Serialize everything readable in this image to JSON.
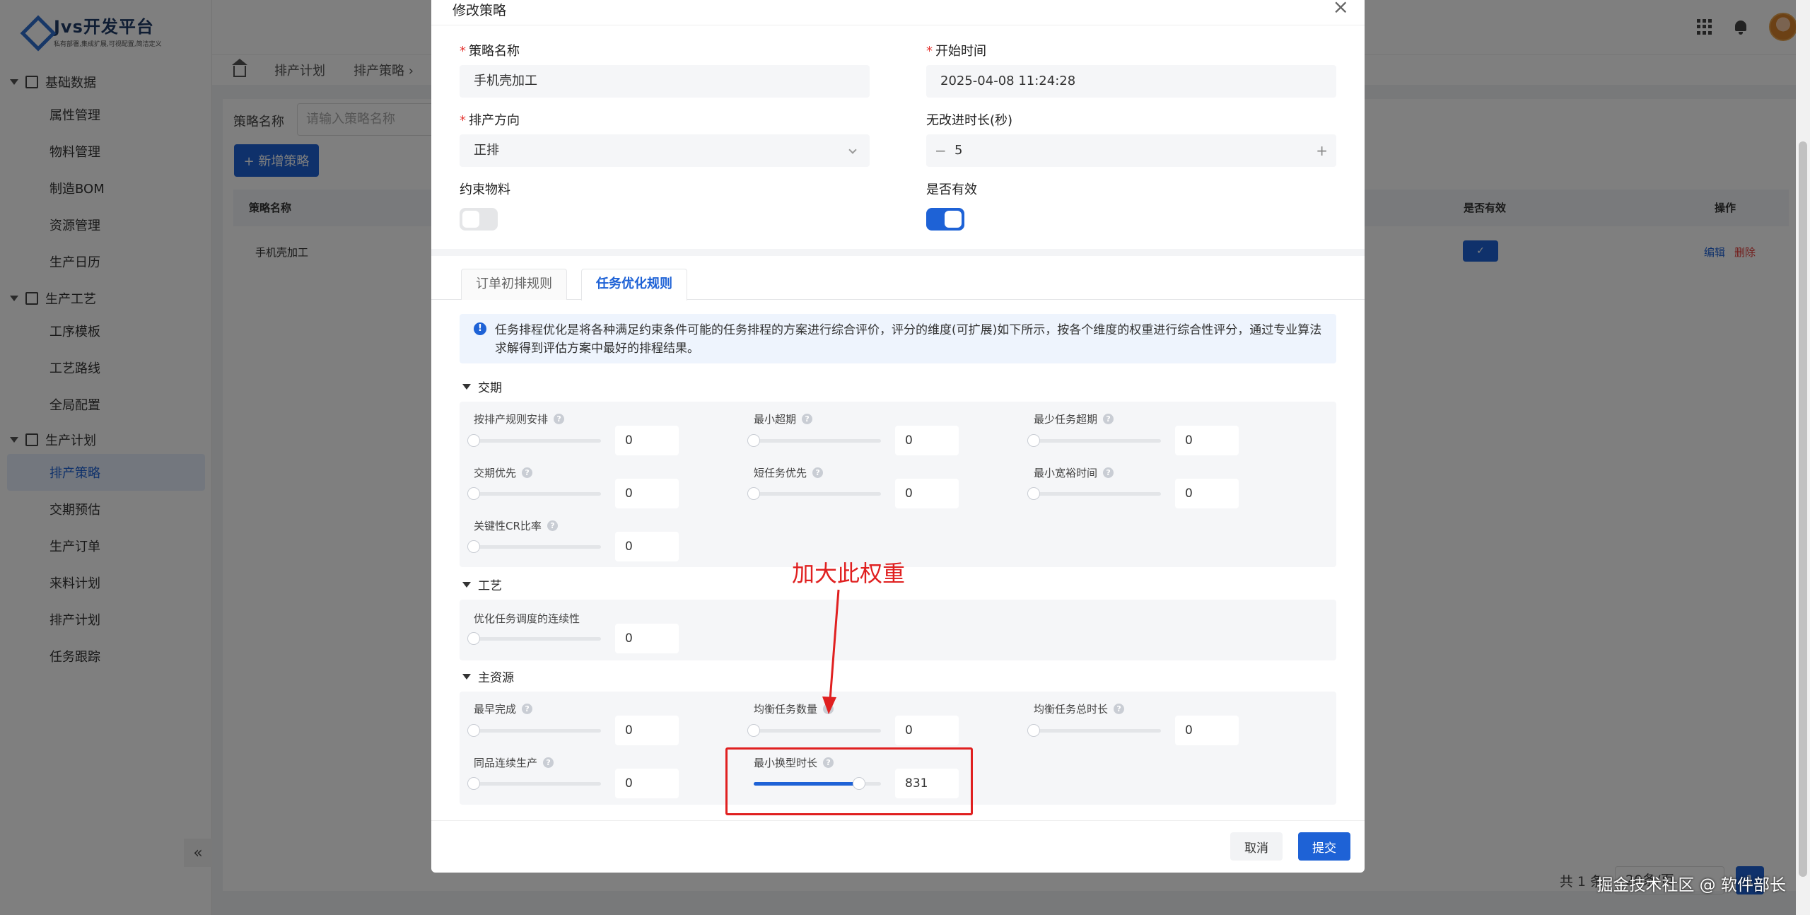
{
  "app": {
    "logo_title": "Jvs开发平台",
    "logo_subtitle": "私有部署,集成扩展,可视配置,简洁定义"
  },
  "sidebar": {
    "groups": [
      {
        "title": "基础数据",
        "items": [
          "属性管理",
          "物料管理",
          "制造BOM",
          "资源管理",
          "生产日历"
        ]
      },
      {
        "title": "生产工艺",
        "items": [
          "工序模板",
          "工艺路线",
          "全局配置"
        ]
      },
      {
        "title": "生产计划",
        "items": [
          "排产策略",
          "交期预估",
          "生产订单",
          "来料计划",
          "排产计划",
          "任务跟踪"
        ]
      }
    ],
    "active": "排产策略",
    "collapse_label": "«"
  },
  "breadcrumb": {
    "tabs": [
      "排产计划",
      "排产策略 ›"
    ]
  },
  "page": {
    "filter_label": "策略名称",
    "filter_placeholder": "请输入策略名称",
    "add_button": "+ 新增策略",
    "table_headers": {
      "name": "策略名称",
      "valid": "是否有效",
      "ops": "操作"
    },
    "row": {
      "name": "手机壳加工",
      "edit": "编辑",
      "delete": "删除",
      "valid_mark": "✓"
    },
    "total": "共 1 条",
    "page_size": "20条/页",
    "page_num": "1"
  },
  "dialog": {
    "title": "修改策略",
    "close": "×",
    "fields": {
      "name_label": "策略名称",
      "name_value": "手机壳加工",
      "start_label": "开始时间",
      "start_value": "2025-04-08 11:24:28",
      "direction_label": "排产方向",
      "direction_value": "正排",
      "idle_label": "无改进时长(秒)",
      "idle_value": "5",
      "minus": "−",
      "plus": "+",
      "constraint_label": "约束物料",
      "valid_label": "是否有效"
    },
    "tabs": [
      "订单初排规则",
      "任务优化规则"
    ],
    "info": "任务排程优化是将各种满足约束条件可能的任务排程的方案进行综合评价，评分的维度(可扩展)如下所示，按各个维度的权重进行综合性评分，通过专业算法求解得到评估方案中最好的排程结果。",
    "sections": {
      "delivery": {
        "title": "交期",
        "items": [
          {
            "label": "按排产规则安排",
            "value": "0",
            "level": 0
          },
          {
            "label": "最小超期",
            "value": "0",
            "level": 0
          },
          {
            "label": "最少任务超期",
            "value": "0",
            "level": 0
          },
          {
            "label": "交期优先",
            "value": "0",
            "level": 0
          },
          {
            "label": "短任务优先",
            "value": "0",
            "level": 0
          },
          {
            "label": "最小宽裕时间",
            "value": "0",
            "level": 0
          },
          {
            "label": "关键性CR比率",
            "value": "0",
            "level": 0
          }
        ]
      },
      "process": {
        "title": "工艺",
        "items": [
          {
            "label": "优化任务调度的连续性",
            "value": "0",
            "level": 0
          }
        ]
      },
      "resource": {
        "title": "主资源",
        "items": [
          {
            "label": "最早完成",
            "value": "0",
            "level": 0
          },
          {
            "label": "均衡任务数量",
            "value": "0",
            "level": 0
          },
          {
            "label": "均衡任务总时长",
            "value": "0",
            "level": 0
          },
          {
            "label": "同品连续生产",
            "value": "0",
            "level": 0
          },
          {
            "label": "最小换型时长",
            "value": "831",
            "level": 0.83
          }
        ]
      }
    },
    "help": "?",
    "cancel": "取消",
    "submit": "提交"
  },
  "annotation": {
    "text": "加大此权重",
    "color": "#e02020"
  },
  "watermark": "掘金技术社区 @ 软件部长",
  "colors": {
    "primary": "#1e62d6",
    "danger": "#e53935"
  }
}
